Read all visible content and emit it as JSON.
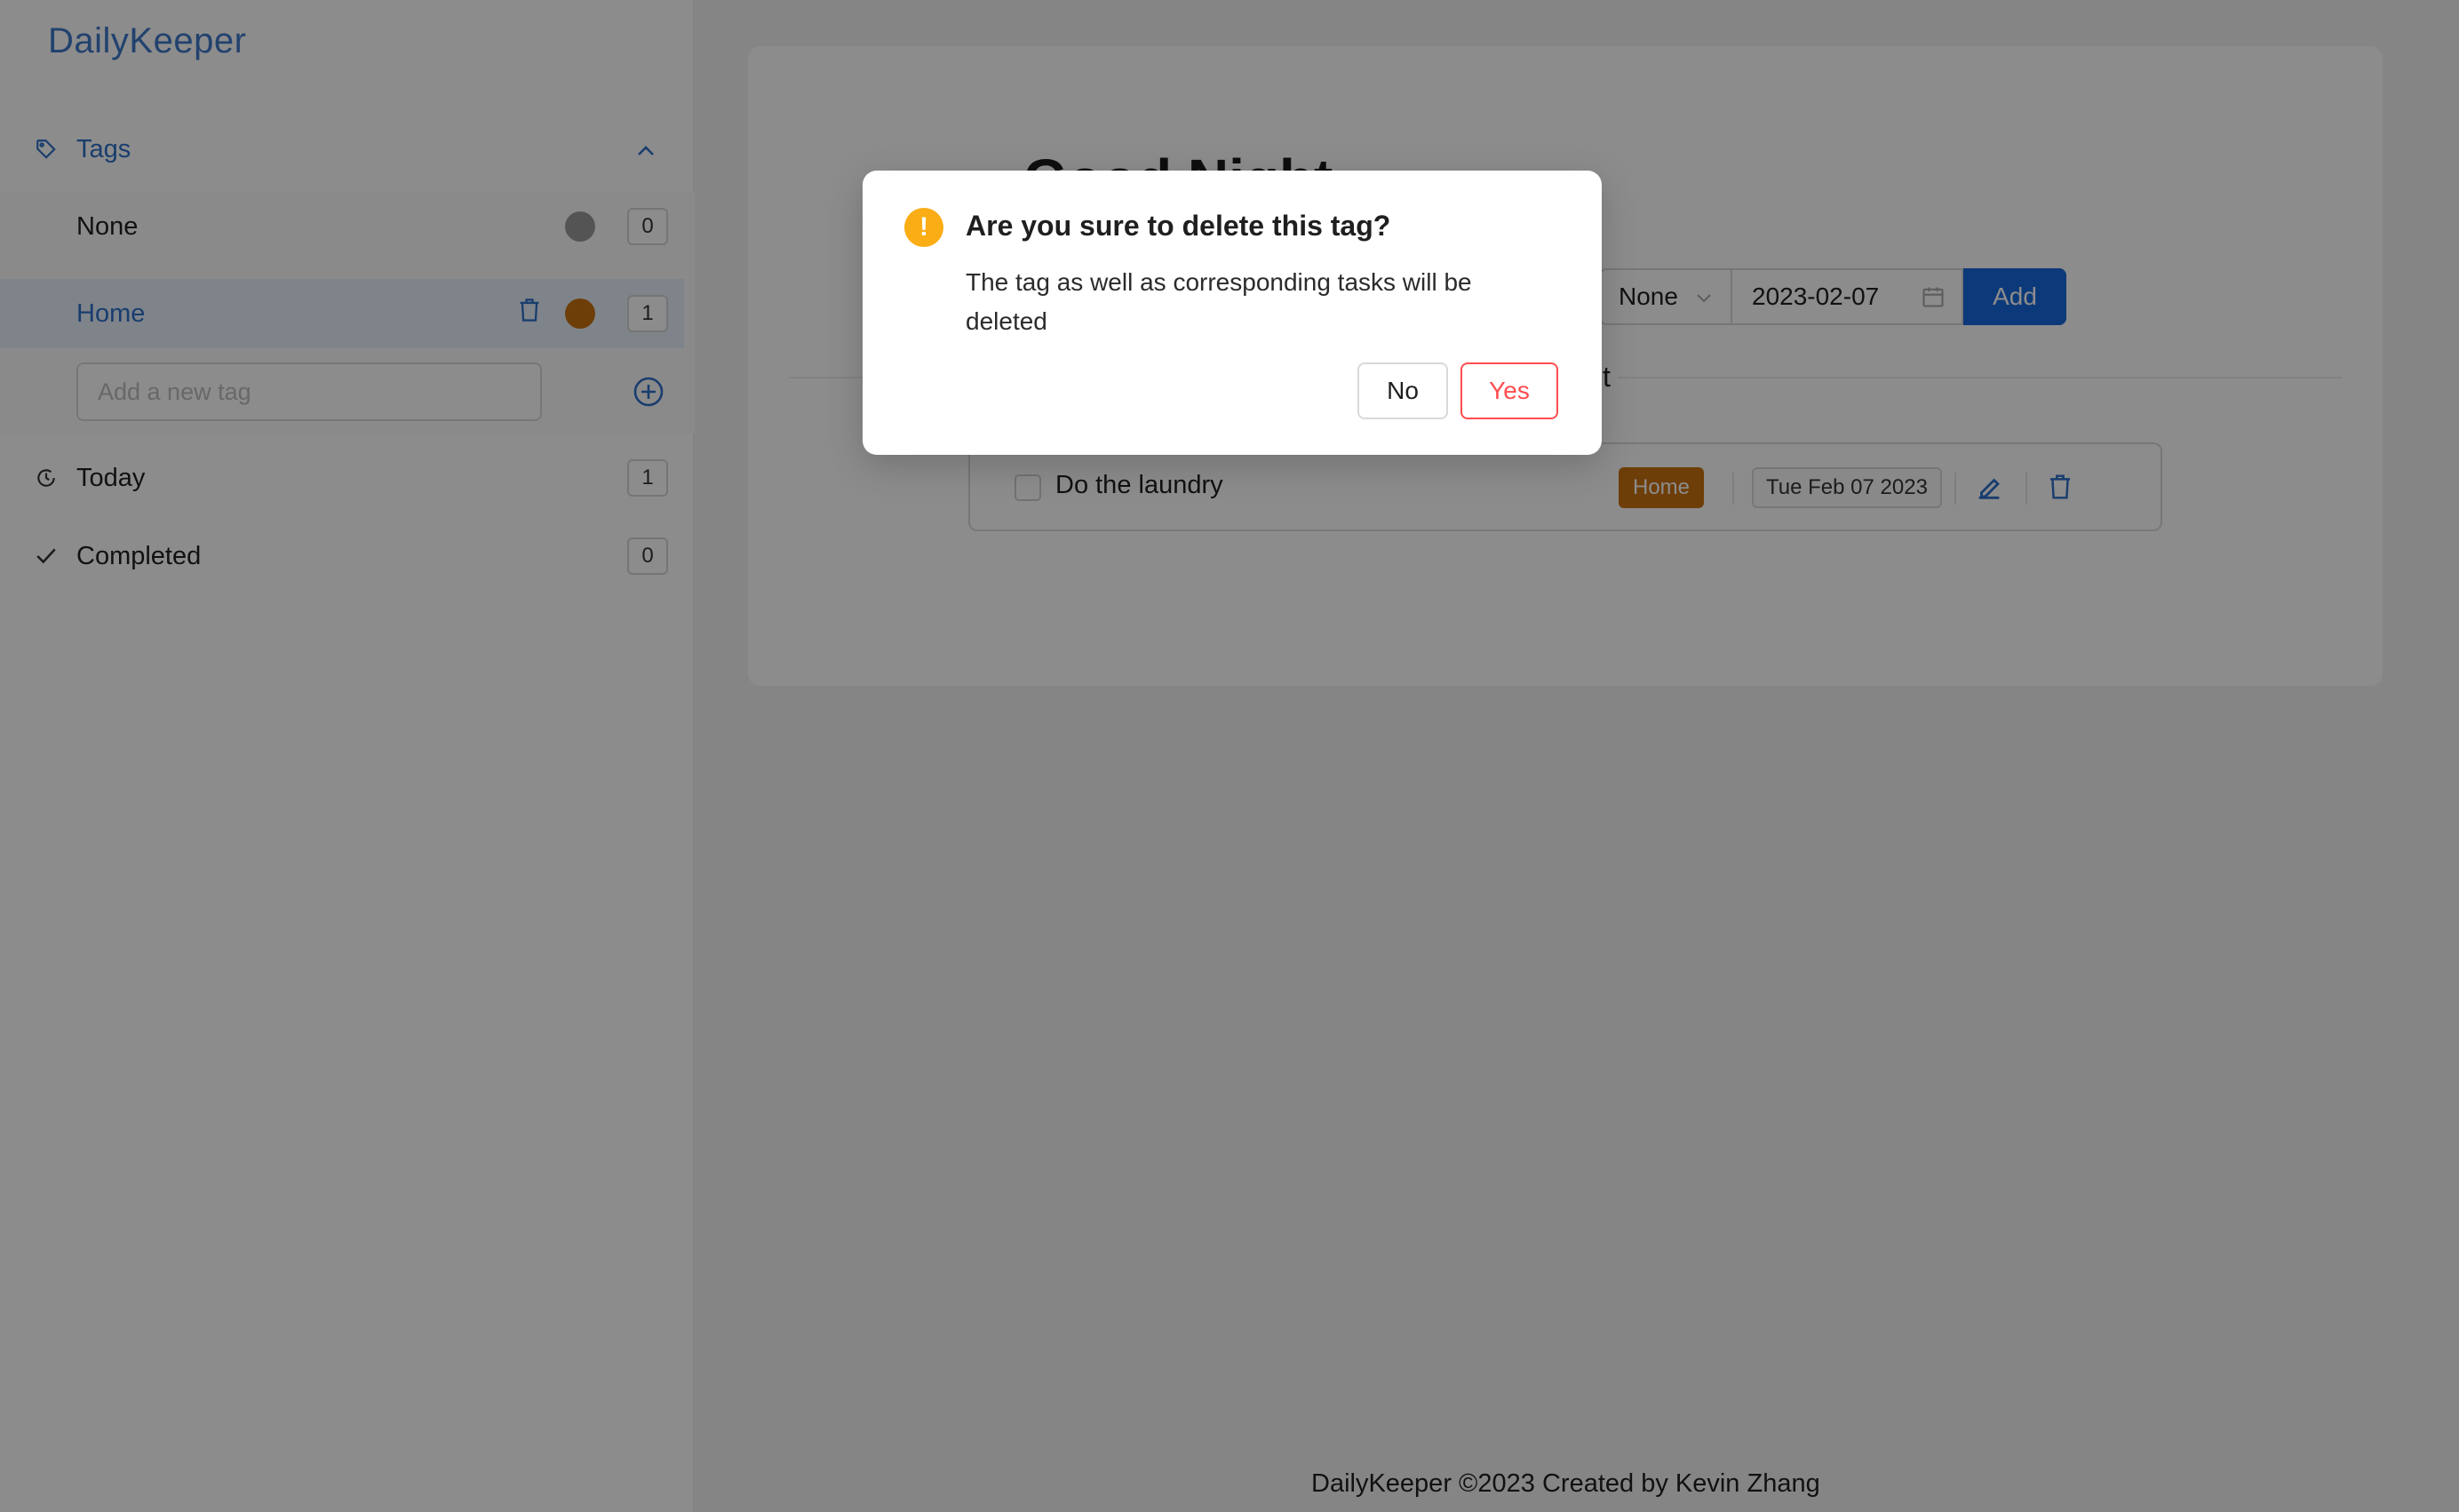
{
  "app": {
    "brand": "DailyKeeper"
  },
  "sidebar": {
    "tags_label": "Tags",
    "tags": [
      {
        "label": "None",
        "color": "#9a9a9a",
        "count": "0"
      },
      {
        "label": "Home",
        "color": "#c8720f",
        "count": "1"
      }
    ],
    "new_tag_placeholder": "Add a new tag",
    "today": {
      "label": "Today",
      "count": "1"
    },
    "completed": {
      "label": "Completed",
      "count": "0"
    }
  },
  "main": {
    "greeting": "Good Night",
    "tag_select": "None",
    "date_value": "2023-02-07",
    "add_label": "Add",
    "section_title": "st",
    "tasks": [
      {
        "text": "Do the laundry",
        "tag": "Home",
        "date": "Tue Feb 07 2023"
      }
    ]
  },
  "footer": {
    "text": "DailyKeeper ©2023 Created by Kevin Zhang"
  },
  "modal": {
    "title": "Are you sure to delete this tag?",
    "body": "The tag as well as corresponding tasks will be deleted",
    "no_label": "No",
    "yes_label": "Yes"
  },
  "colors": {
    "accent": "#1668dc",
    "link": "#2f6fc9",
    "warning": "#faad14",
    "danger": "#ff4d4f",
    "home_tag": "#c8720f"
  }
}
